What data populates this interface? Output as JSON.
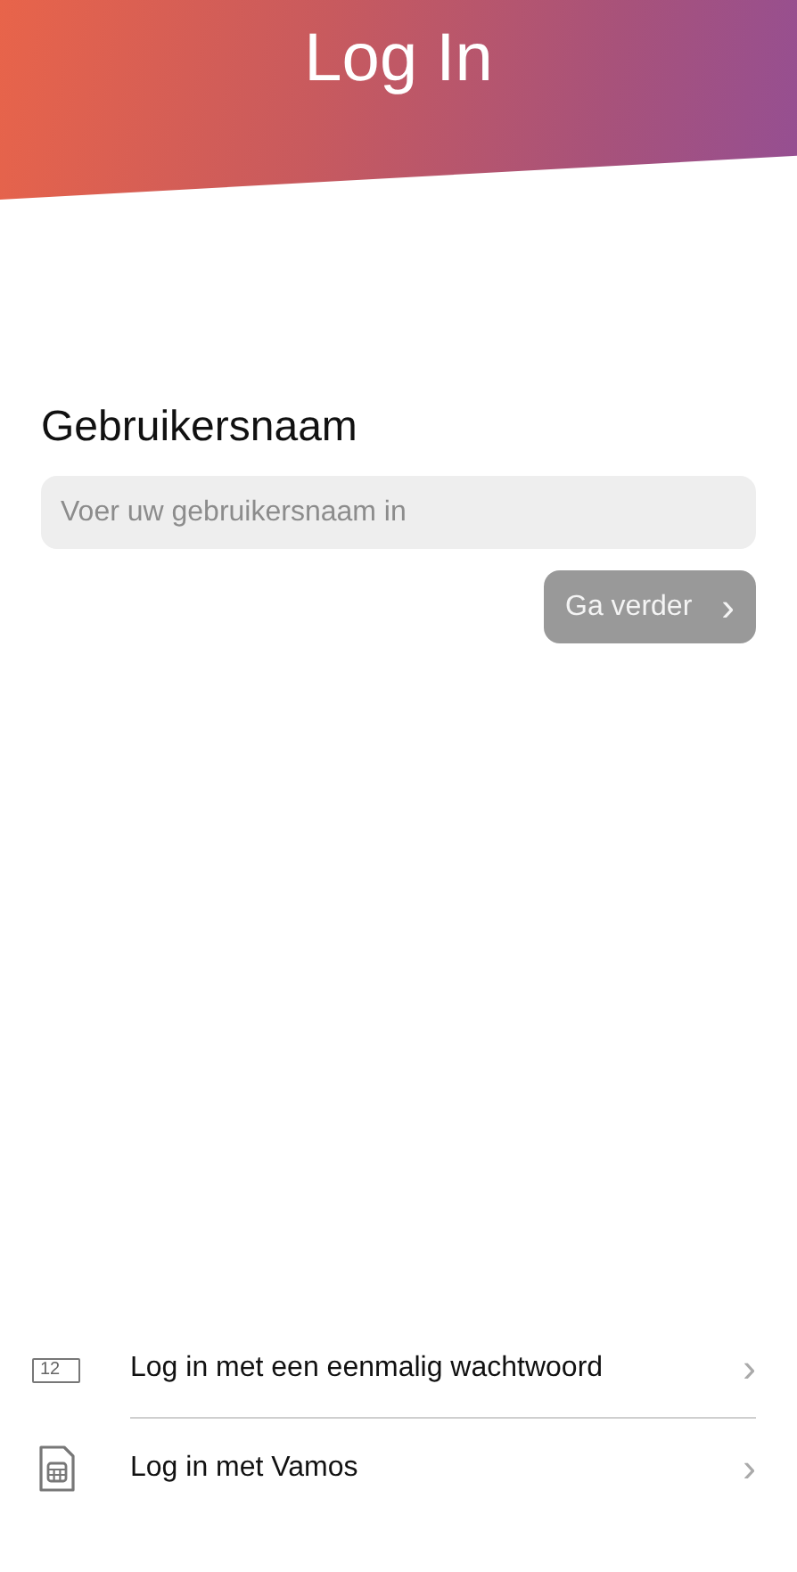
{
  "header": {
    "title": "Log In"
  },
  "form": {
    "label": "Gebruikersnaam",
    "placeholder": "Voer uw gebruikersnaam in",
    "button": {
      "label": "Ga verder",
      "chevron": "›",
      "disabled": true
    }
  },
  "options": [
    {
      "kind": "otp",
      "icon_text": "12",
      "label": "Log in met een eenmalig wachtwoord",
      "chevron": "›"
    },
    {
      "kind": "sim",
      "label": "Log in met Vamos",
      "chevron": "›"
    }
  ]
}
